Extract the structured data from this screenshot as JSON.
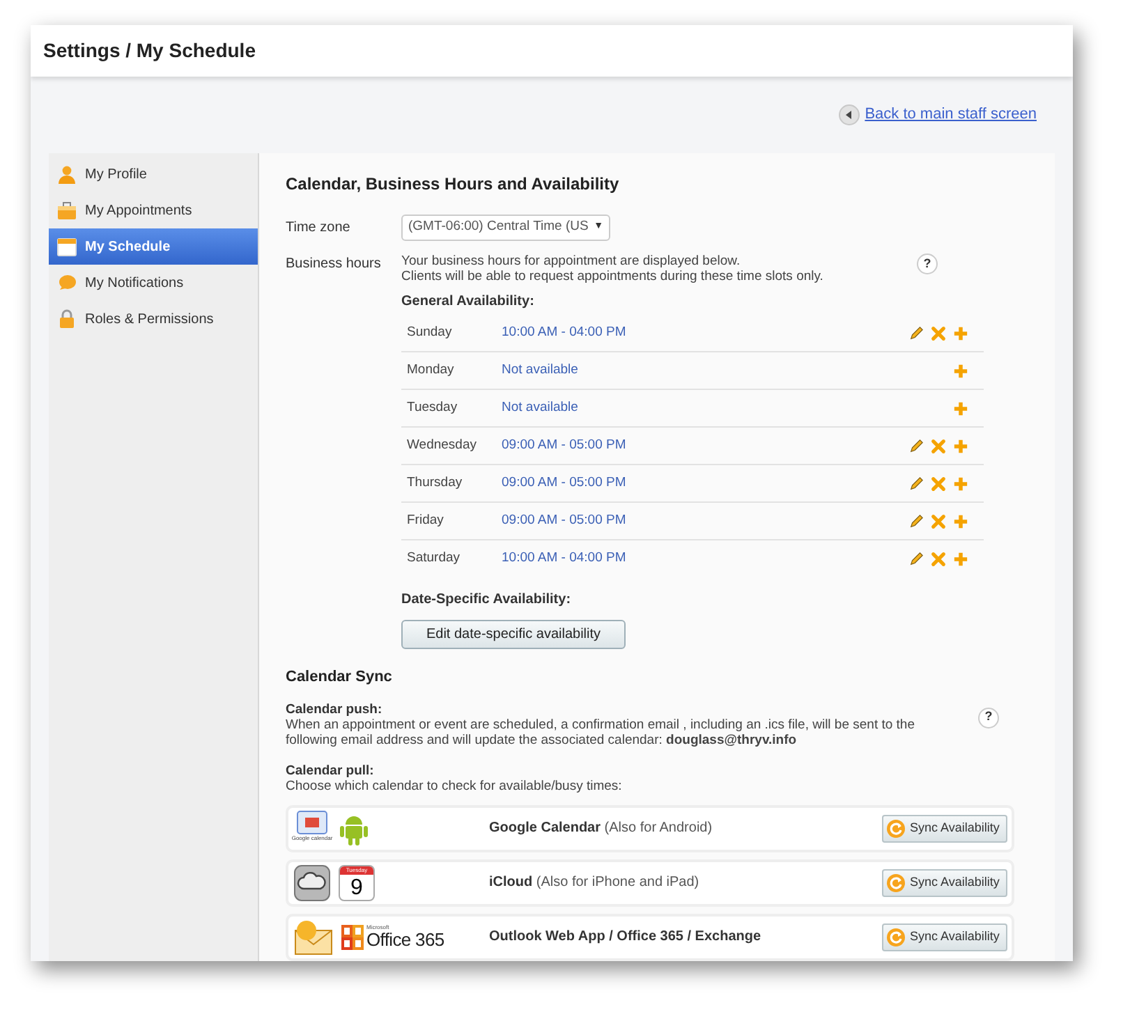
{
  "window": {
    "title": "Settings / My Schedule"
  },
  "back_link": {
    "label": "Back to main staff screen"
  },
  "sidebar": {
    "items": [
      {
        "label": "My Profile",
        "kind": "person",
        "selected": false
      },
      {
        "label": "My Appointments",
        "kind": "briefcase",
        "selected": false
      },
      {
        "label": "My Schedule",
        "kind": "calendar",
        "selected": true
      },
      {
        "label": "My Notifications",
        "kind": "bubble",
        "selected": false
      },
      {
        "label": "Roles & Permissions",
        "kind": "lock",
        "selected": false
      }
    ]
  },
  "availability": {
    "title": "Calendar, Business Hours and Availability",
    "time_zone": {
      "label": "Time zone",
      "value": "(GMT-06:00) Central Time (US",
      "caret": "▼"
    },
    "business_hours": {
      "label": "Business hours",
      "note": "Your business hours for appointment are displayed below.",
      "note_2": "Clients will be able to request appointments during these time slots only.",
      "help": "?"
    },
    "general_title": "General Availability:",
    "days": [
      {
        "day": "Sunday",
        "hours": "10:00 AM - 04:00 PM",
        "editable": true
      },
      {
        "day": "Monday",
        "hours": "Not available",
        "editable": false
      },
      {
        "day": "Tuesday",
        "hours": "Not available",
        "editable": false
      },
      {
        "day": "Wednesday",
        "hours": "09:00 AM - 05:00 PM",
        "editable": true
      },
      {
        "day": "Thursday",
        "hours": "09:00 AM - 05:00 PM",
        "editable": true
      },
      {
        "day": "Friday",
        "hours": "09:00 AM - 05:00 PM",
        "editable": true
      },
      {
        "day": "Saturday",
        "hours": "10:00 AM - 04:00 PM",
        "editable": true
      }
    ],
    "date_specific_title": "Date-Specific Availability:",
    "date_specific_button": "Edit date-specific availability"
  },
  "sync": {
    "title": "Calendar Sync",
    "push": {
      "title": "Calendar push:",
      "text": "When an appointment or event are scheduled, a confirmation email , including an .ics file, will be sent to the following email address and will update the associated calendar: **douglass@thryv.info**",
      "help": "?"
    },
    "pull": {
      "title": "Calendar pull:",
      "text": "Choose which calendar to check for available/busy times:"
    },
    "providers": [
      {
        "kind": "google",
        "name": "Google Calendar",
        "note": "(Also for Android)",
        "logo_text": "Google calendar",
        "button": "Sync Availability"
      },
      {
        "kind": "icloud",
        "name": "iCloud",
        "note": "(Also for iPhone and iPad)",
        "logo_text": "Tuesday",
        "logo_text_2": "9",
        "button": "Sync Availability"
      },
      {
        "kind": "office",
        "name": "Outlook Web App / Office 365 / Exchange",
        "logo_text": "Microsoft",
        "logo_text_2": "Office 365",
        "button": "Sync Availability"
      }
    ]
  }
}
